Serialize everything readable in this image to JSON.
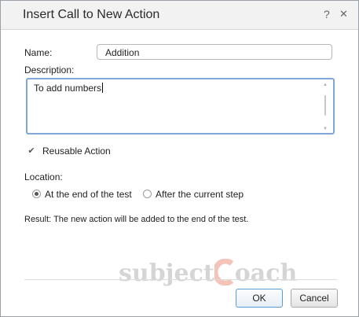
{
  "dialog": {
    "title": "Insert Call to New Action",
    "help_glyph": "?",
    "close_glyph": "✕"
  },
  "form": {
    "name_label": "Name:",
    "name_value": "Addition",
    "description_label": "Description:",
    "description_value": "To add numbers",
    "reusable_label": "Reusable Action",
    "reusable_checked": true,
    "location_label": "Location:",
    "location_options": [
      "At the end of the test",
      "After the current step"
    ],
    "location_selected": "At the end of the test",
    "result_text": "Result: The new action will be added to the end of the test."
  },
  "buttons": {
    "ok_label": "OK",
    "cancel_label": "Cancel"
  },
  "watermark": {
    "text_left": "subject",
    "text_right": "oach",
    "accent_color": "#e05a3a"
  },
  "colors": {
    "focus_border": "#7fa8d8",
    "ok_border": "#5b9bd5"
  },
  "icons": [
    "help-icon",
    "close-icon",
    "checkmark-icon",
    "scroll-up-icon",
    "scroll-down-icon"
  ]
}
